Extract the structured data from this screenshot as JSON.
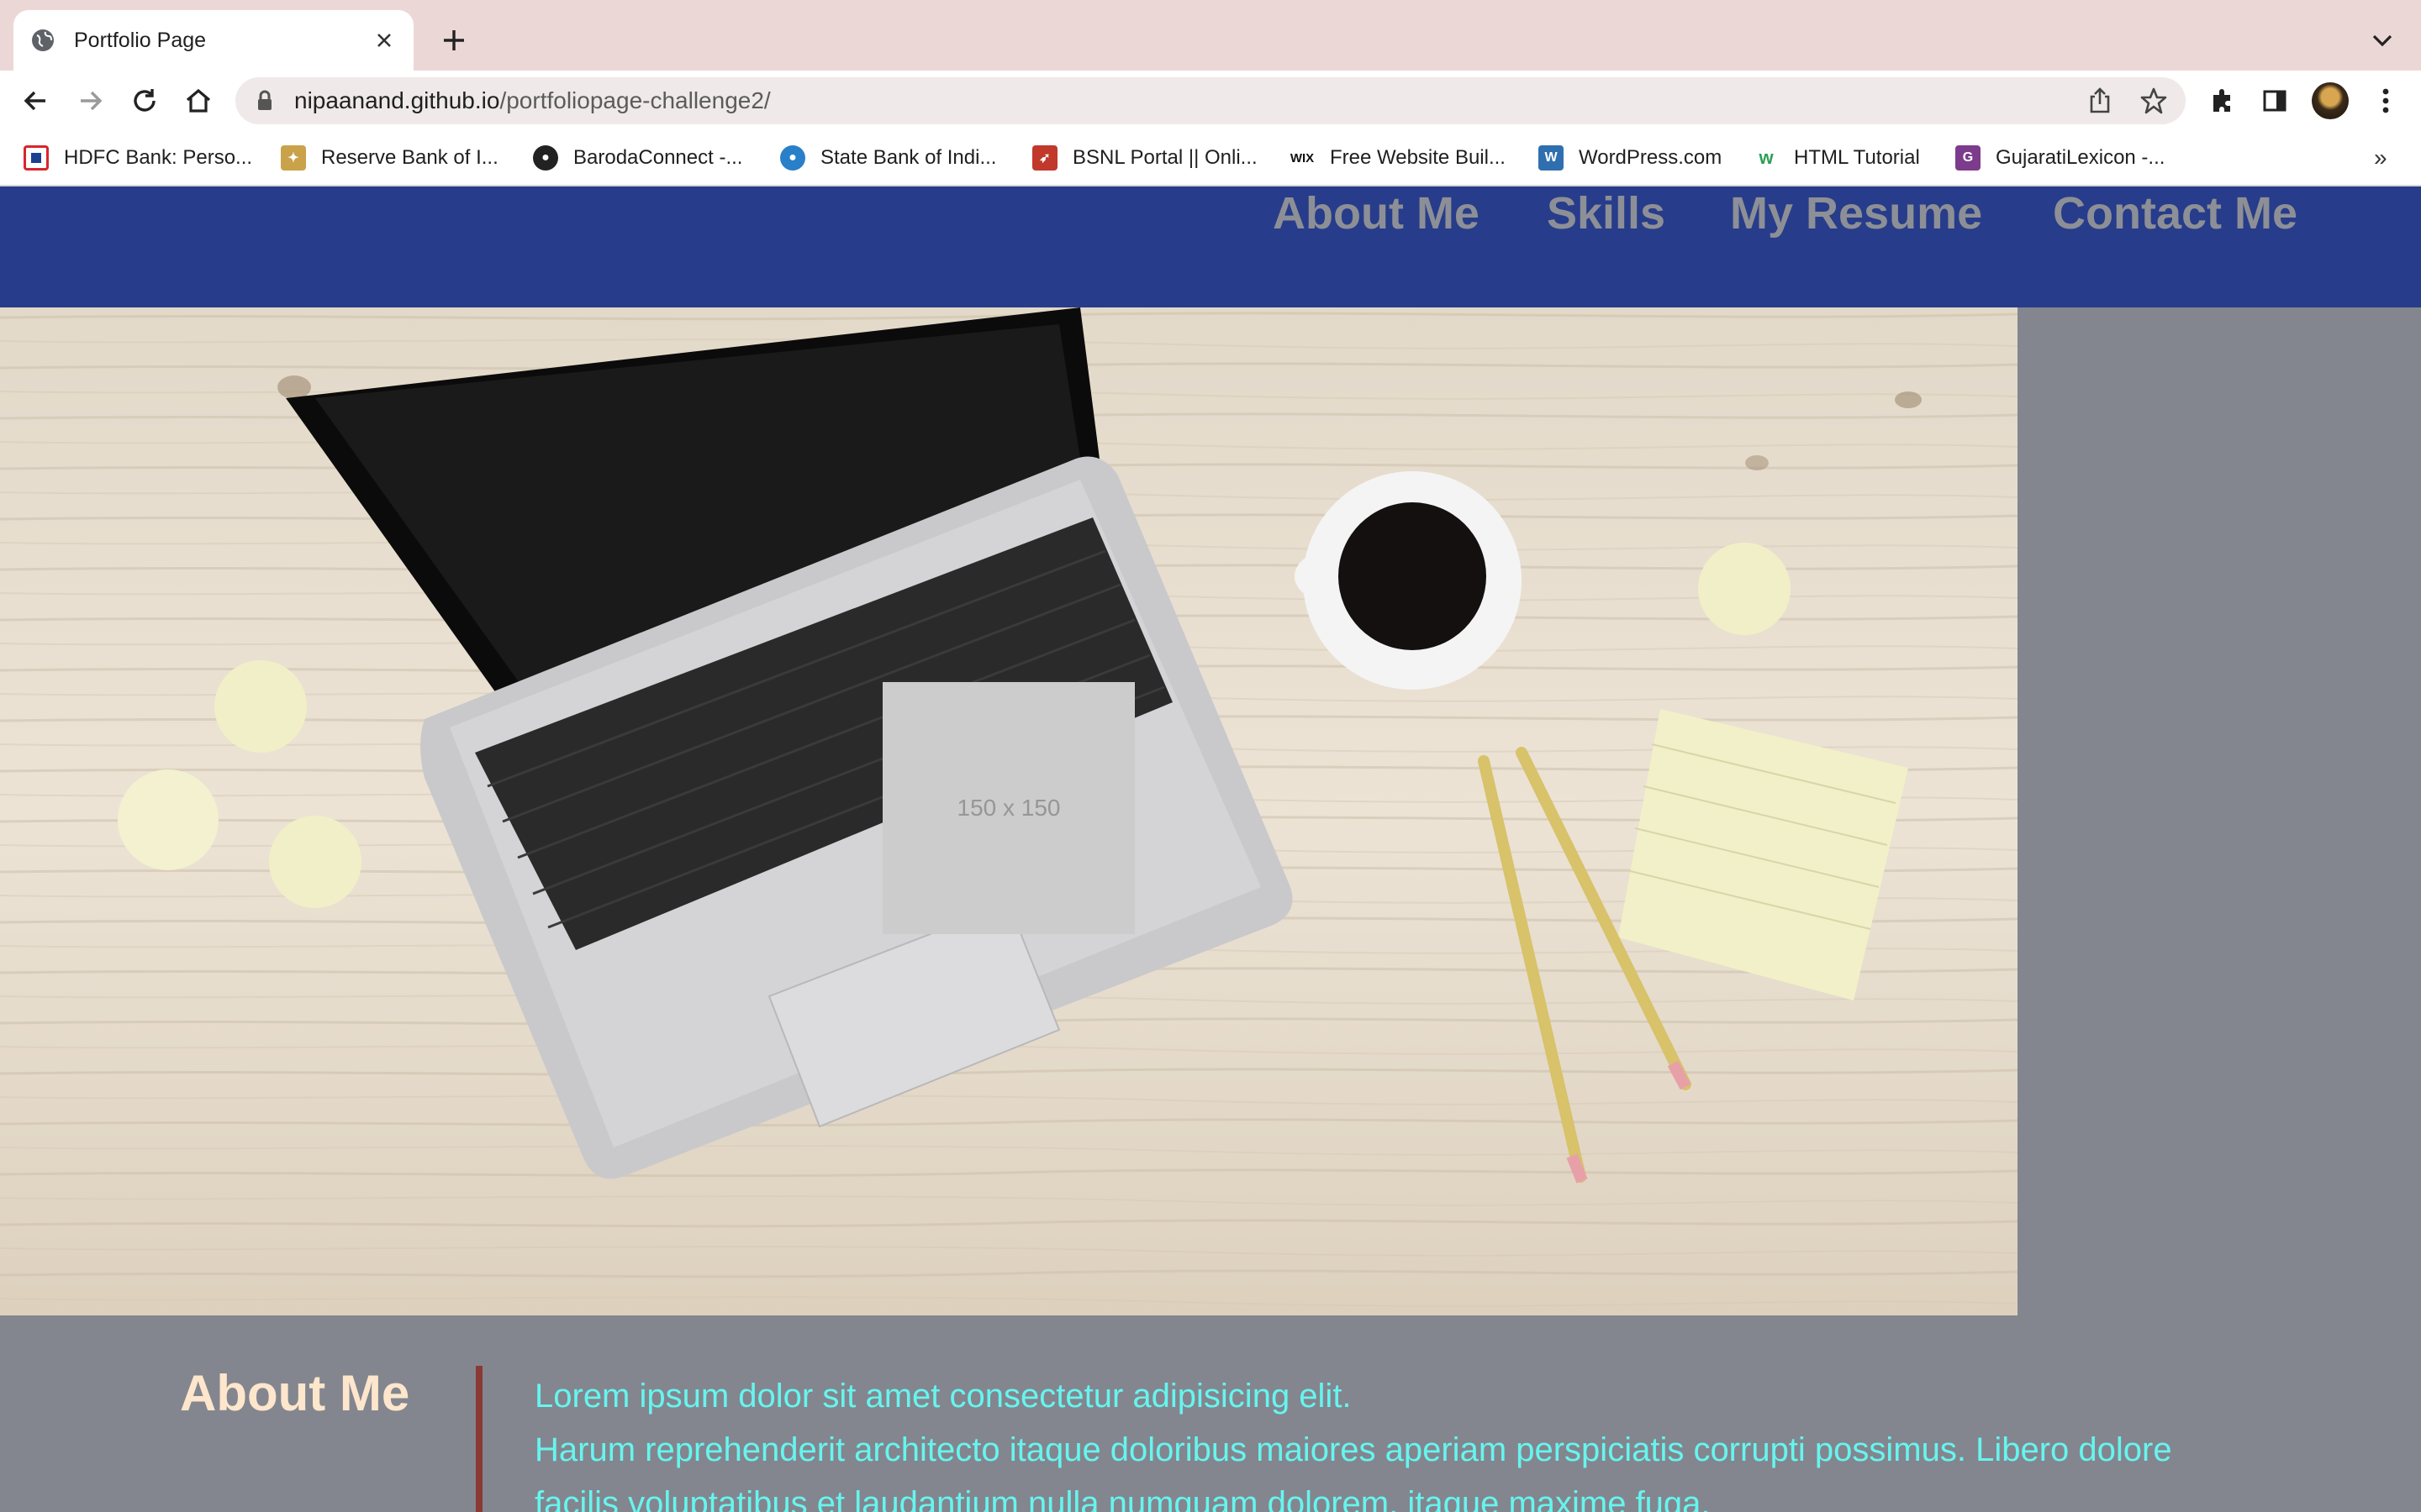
{
  "browser": {
    "tab_title": "Portfolio Page",
    "url_host": "nipaanand.github.io",
    "url_path": "/portfoliopage-challenge2/",
    "bookmarks": [
      {
        "label": "HDFC Bank: Perso...",
        "icon": "hdfc-icon",
        "color": "#d7262b"
      },
      {
        "label": "Reserve Bank of I...",
        "icon": "rbi-icon",
        "color": "#c9a24a"
      },
      {
        "label": "BarodaConnect -...",
        "icon": "globe-icon",
        "color": "#222222"
      },
      {
        "label": "State Bank of Indi...",
        "icon": "sbi-icon",
        "color": "#2a7fc9"
      },
      {
        "label": "BSNL Portal || Onli...",
        "icon": "bsnl-icon",
        "color": "#c0392b"
      },
      {
        "label": "Free Website Buil...",
        "icon": "wix-icon",
        "color": "#111111"
      },
      {
        "label": "WordPress.com",
        "icon": "wordpress-icon",
        "color": "#2f6fb0"
      },
      {
        "label": "HTML Tutorial",
        "icon": "w3schools-icon",
        "color": "#2e9e56"
      },
      {
        "label": "GujaratiLexicon -...",
        "icon": "gujaratilexicon-icon",
        "color": "#7d3b8c"
      }
    ]
  },
  "nav": {
    "items": [
      "About Me",
      "Skills",
      "My Resume",
      "Contact Me"
    ]
  },
  "hero": {
    "placeholder_text": "150 x 150"
  },
  "about": {
    "heading": "About Me",
    "line1": "Lorem ipsum dolor sit amet consectetur adipisicing elit.",
    "line2": "Harum reprehenderit architecto itaque doloribus maiores aperiam perspiciatis corrupti possimus. Libero dolore facilis voluptatibus et laudantium nulla numquam dolorem, itaque maxime fuga."
  },
  "colors": {
    "header": "#273c8a",
    "nav_text": "#8d8f96",
    "page_bg": "#83868f",
    "about_heading": "#fde6cc",
    "about_text": "#66f5ee",
    "about_rule": "#8a3a35"
  }
}
